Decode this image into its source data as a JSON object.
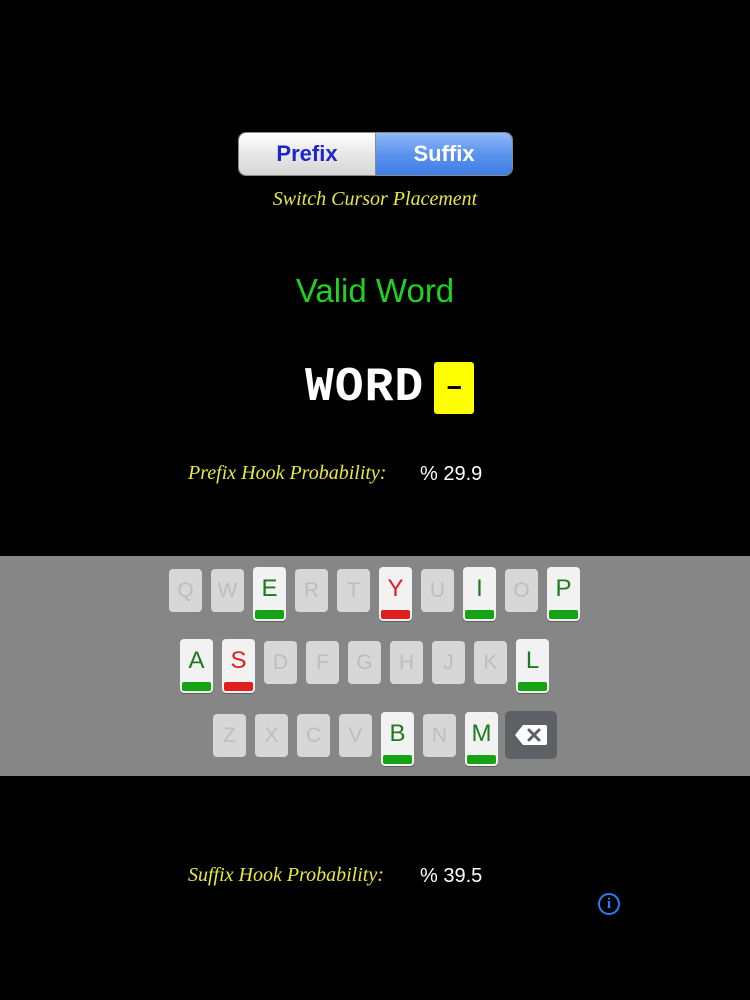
{
  "segment": {
    "prefix_label": "Prefix",
    "suffix_label": "Suffix",
    "selected": "Suffix"
  },
  "switch_caption": "Switch Cursor Placement",
  "status_text": "Valid Word",
  "word": "WORD",
  "cursor_symbol": "–",
  "prefix_hook": {
    "label": "Prefix Hook Probability:",
    "value": "% 29.9"
  },
  "suffix_hook": {
    "label": "Suffix Hook Probability:",
    "value": "% 39.5"
  },
  "keyboard": {
    "row1": [
      {
        "label": "Q",
        "state": "off"
      },
      {
        "label": "W",
        "state": "off"
      },
      {
        "label": "E",
        "state": "green"
      },
      {
        "label": "R",
        "state": "off"
      },
      {
        "label": "T",
        "state": "off"
      },
      {
        "label": "Y",
        "state": "red"
      },
      {
        "label": "U",
        "state": "off"
      },
      {
        "label": "I",
        "state": "green"
      },
      {
        "label": "O",
        "state": "off"
      },
      {
        "label": "P",
        "state": "green"
      }
    ],
    "row2": [
      {
        "label": "A",
        "state": "green"
      },
      {
        "label": "S",
        "state": "red"
      },
      {
        "label": "D",
        "state": "off"
      },
      {
        "label": "F",
        "state": "off"
      },
      {
        "label": "G",
        "state": "off"
      },
      {
        "label": "H",
        "state": "off"
      },
      {
        "label": "J",
        "state": "off"
      },
      {
        "label": "K",
        "state": "off"
      },
      {
        "label": "L",
        "state": "green"
      }
    ],
    "row3": [
      {
        "label": "Z",
        "state": "off"
      },
      {
        "label": "X",
        "state": "off"
      },
      {
        "label": "C",
        "state": "off"
      },
      {
        "label": "V",
        "state": "off"
      },
      {
        "label": "B",
        "state": "green"
      },
      {
        "label": "N",
        "state": "off"
      },
      {
        "label": "M",
        "state": "green"
      }
    ],
    "backspace_icon": "backspace-icon"
  },
  "info_icon": "info-icon",
  "colors": {
    "green": "#1ed21e",
    "yellow_caption": "#e9e93a",
    "red_bar": "#e01e1e",
    "green_bar": "#13a313",
    "segment_selected": "#4a87ea"
  }
}
